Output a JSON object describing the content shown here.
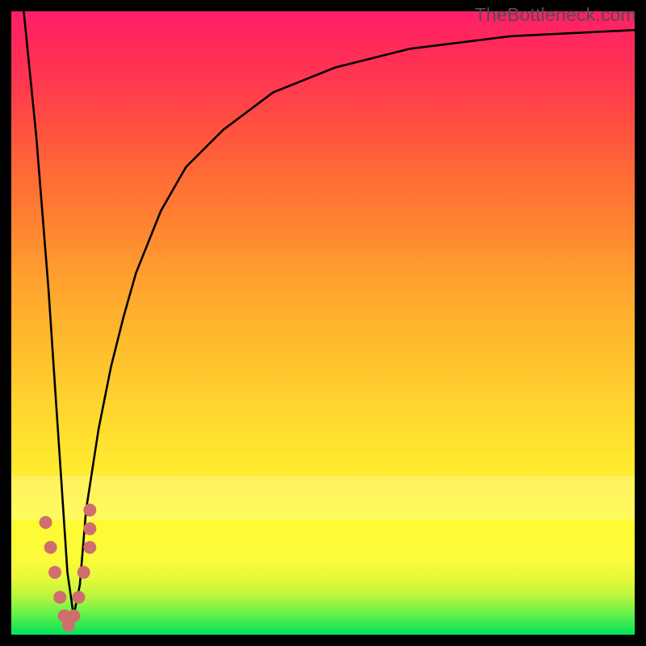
{
  "watermark": "TheBottleneck.com",
  "chart_data": {
    "type": "line",
    "title": "",
    "xlabel": "",
    "ylabel": "",
    "xlim": [
      0,
      100
    ],
    "ylim": [
      0,
      100
    ],
    "grid": false,
    "legend": false,
    "series": [
      {
        "name": "bottleneck-curve",
        "color": "#000000",
        "x": [
          0,
          2,
          4,
          6,
          7,
          8,
          9,
          10,
          11,
          12,
          14,
          16,
          18,
          20,
          24,
          28,
          34,
          42,
          52,
          64,
          80,
          100
        ],
        "values": [
          120,
          100,
          80,
          55,
          40,
          25,
          10,
          3,
          8,
          20,
          33,
          43,
          51,
          58,
          68,
          75,
          81,
          87,
          91,
          94,
          96,
          97
        ]
      },
      {
        "name": "highlight-points",
        "color": "#cf6e6e",
        "style": "scatter",
        "x": [
          5.5,
          6.3,
          7.0,
          7.8,
          8.5,
          9.2,
          10.0,
          10.8,
          11.6,
          12.6,
          12.6,
          12.6
        ],
        "values": [
          18,
          14,
          10,
          6,
          3,
          1.5,
          3,
          6,
          10,
          14,
          17,
          20
        ]
      }
    ],
    "background": {
      "type": "vertical-gradient",
      "stops": [
        {
          "pos": 0,
          "color": "#00e35a"
        },
        {
          "pos": 10,
          "color": "#e6f93a"
        },
        {
          "pos": 20,
          "color": "#fffb32"
        },
        {
          "pos": 40,
          "color": "#ffd12e"
        },
        {
          "pos": 60,
          "color": "#ff9e2f"
        },
        {
          "pos": 80,
          "color": "#ff5a3a"
        },
        {
          "pos": 100,
          "color": "#ff1f68"
        }
      ]
    }
  }
}
